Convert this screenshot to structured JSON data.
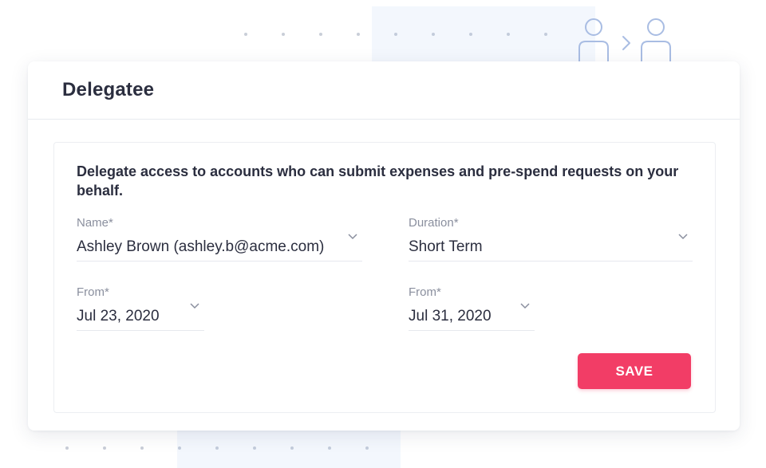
{
  "card": {
    "title": "Delegatee",
    "description": "Delegate access to accounts who can submit expenses and pre-spend requests on your behalf."
  },
  "fields": {
    "name": {
      "label": "Name*",
      "value": "Ashley Brown (ashley.b@acme.com)"
    },
    "duration": {
      "label": "Duration*",
      "value": "Short Term"
    },
    "from_start": {
      "label": "From*",
      "value": "Jul 23, 2020"
    },
    "from_end": {
      "label": "From*",
      "value": "Jul 31, 2020"
    }
  },
  "actions": {
    "save_label": "SAVE"
  },
  "colors": {
    "accent": "#f23d66",
    "text": "#2b2e3f",
    "label": "#8a8f9e",
    "icon_stroke": "#a9bde3"
  },
  "icons": {
    "illustration": "people-delegate-icon",
    "dropdown": "chevron-down-icon"
  }
}
